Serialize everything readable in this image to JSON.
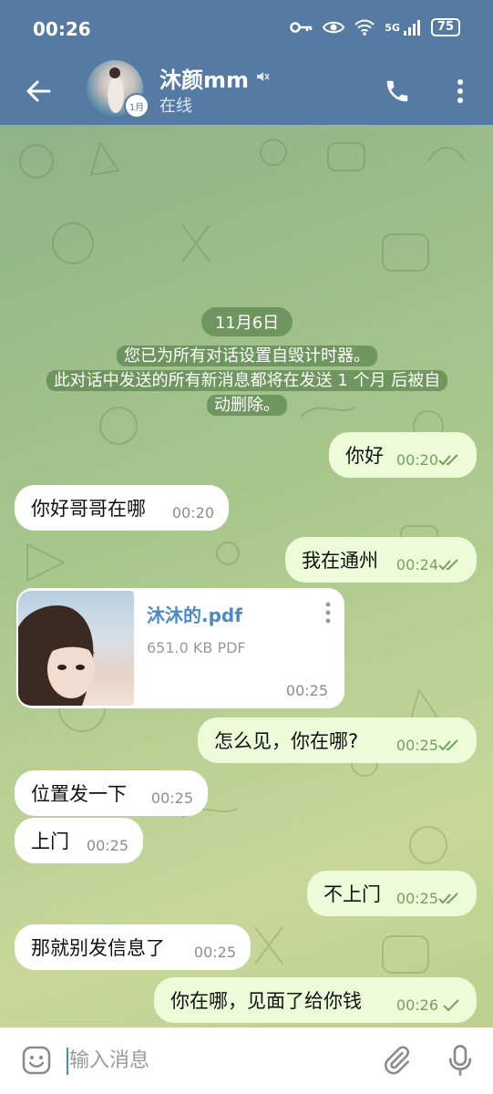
{
  "status_bar": {
    "time": "00:26",
    "network": "5G",
    "battery": "75"
  },
  "header": {
    "contact_name": "沐颜mm",
    "status": "在线",
    "avatar_badge": "1月"
  },
  "chat": {
    "date": "11月6日",
    "service_message": "您已为所有对话设置自毁计时器。此对话中发送的所有新消息都将在发送 1 个月 后被自动删除。",
    "service_lines": [
      "您已为所有对话设置自毁计时器。",
      "此对话中发送的所有新消息都将在发送 1 个月 后被自",
      "动删除。"
    ],
    "messages": [
      {
        "dir": "out",
        "text": "你好",
        "time": "00:20",
        "read": true
      },
      {
        "dir": "in",
        "text": "你好哥哥在哪",
        "time": "00:20"
      },
      {
        "dir": "out",
        "text": "我在通州",
        "time": "00:24",
        "read": true
      },
      {
        "dir": "in",
        "type": "file",
        "file_name": "沐沐的.pdf",
        "file_size": "651.0 KB PDF",
        "time": "00:25"
      },
      {
        "dir": "out",
        "text": "怎么见，你在哪?",
        "time": "00:25",
        "read": true
      },
      {
        "dir": "in",
        "text": "位置发一下",
        "time": "00:25"
      },
      {
        "dir": "in",
        "text": "上门",
        "time": "00:25"
      },
      {
        "dir": "out",
        "text": "不上门",
        "time": "00:25",
        "read": true
      },
      {
        "dir": "in",
        "text": "那就别发信息了",
        "time": "00:25"
      },
      {
        "dir": "out",
        "text": "你在哪，见面了给你钱",
        "time": "00:26",
        "read": false
      }
    ]
  },
  "input": {
    "placeholder": "输入消息"
  },
  "colors": {
    "header": "#557aa3",
    "out_bubble": "#eefbd9",
    "in_bubble": "#ffffff",
    "check": "#72a15e",
    "link": "#4d8ac0"
  },
  "icons": [
    "back-arrow-icon",
    "mute-icon",
    "phone-icon",
    "more-vertical-icon",
    "emoji-icon",
    "paperclip-icon",
    "microphone-icon",
    "key-icon",
    "eye-icon",
    "wifi-icon",
    "signal-icon"
  ]
}
